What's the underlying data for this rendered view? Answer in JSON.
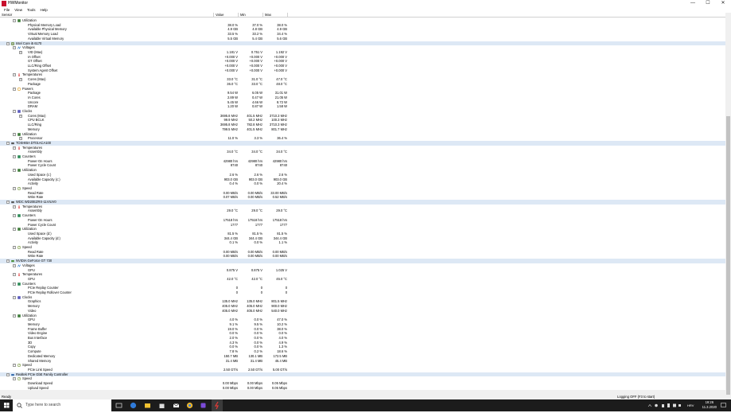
{
  "window": {
    "title": "HWMonitor",
    "minimize": "—",
    "maximize": "☐",
    "close": "✕"
  },
  "menu": [
    "File",
    "View",
    "Tools",
    "Help"
  ],
  "columns": {
    "sensor": "Sensor",
    "value": "Value",
    "min": "Min",
    "max": "Max"
  },
  "rows": [
    {
      "level": 2,
      "exp": "−",
      "icon": "util",
      "label": "Utilization"
    },
    {
      "level": 3,
      "label": "Physical Memory Load",
      "value": "38.0 %",
      "min": "37.0 %",
      "max": "38.0 %"
    },
    {
      "level": 3,
      "label": "Available Physical Memory",
      "value": "4.9 GB",
      "min": "4.8 GB",
      "max": "4.9 GB"
    },
    {
      "level": 3,
      "label": "Virtual Memory Load",
      "value": "33.5 %",
      "min": "33.2 %",
      "max": "34.4 %"
    },
    {
      "level": 3,
      "label": "Available Virtual Memory",
      "value": "5.5 GB",
      "min": "5.4 GB",
      "max": "5.6 GB"
    },
    {
      "level": 1,
      "exp": "−",
      "icon": "cpu",
      "label": "Intel Core i5 6170",
      "hw": true
    },
    {
      "level": 2,
      "exp": "−",
      "icon": "volt",
      "label": "Voltages"
    },
    {
      "level": 3,
      "exp": "+",
      "label": "VID (Max)",
      "value": "1.181 V",
      "min": "0.751 V",
      "max": "1.192 V"
    },
    {
      "level": 3,
      "label": "IA Offset",
      "value": "+0.000 V",
      "min": "+0.000 V",
      "max": "+0.000 V"
    },
    {
      "level": 3,
      "label": "GT Offset",
      "value": "+0.000 V",
      "min": "+0.000 V",
      "max": "+0.000 V"
    },
    {
      "level": 3,
      "label": "LLC/Ring Offset",
      "value": "+0.000 V",
      "min": "+0.000 V",
      "max": "+0.000 V"
    },
    {
      "level": 3,
      "label": "System Agent Offset",
      "value": "+0.000 V",
      "min": "+0.000 V",
      "max": "+0.000 V"
    },
    {
      "level": 2,
      "exp": "−",
      "icon": "temp",
      "label": "Temperatures"
    },
    {
      "level": 3,
      "exp": "+",
      "label": "Cores (Max)",
      "value": "33.0 °C",
      "min": "31.0 °C",
      "max": "47.0 °C"
    },
    {
      "level": 3,
      "label": "Package",
      "value": "36.0 °C",
      "min": "33.0 °C",
      "max": "48.0 °C"
    },
    {
      "level": 2,
      "exp": "−",
      "icon": "power",
      "label": "Powers"
    },
    {
      "level": 3,
      "label": "Package",
      "value": "9.54 W",
      "min": "6.05 W",
      "max": "31.01 W"
    },
    {
      "level": 3,
      "label": "IA Cores",
      "value": "2.89 W",
      "min": "0.47 W",
      "max": "21.05 W"
    },
    {
      "level": 3,
      "label": "Uncore",
      "value": "5.45 W",
      "min": "4.66 W",
      "max": "8.72 W"
    },
    {
      "level": 3,
      "label": "DRAM",
      "value": "1.20 W",
      "min": "0.87 W",
      "max": "1.58 W"
    },
    {
      "level": 2,
      "exp": "−",
      "icon": "clock",
      "label": "Clocks"
    },
    {
      "level": 3,
      "exp": "+",
      "label": "Cores (Max)",
      "value": "3695.8 MHz",
      "min": "401.5 MHz",
      "max": "3710.3 MHz"
    },
    {
      "level": 3,
      "label": "CPU BCLK",
      "value": "99.9 MHz",
      "min": "50.2 MHz",
      "max": "100.3 MHz"
    },
    {
      "level": 3,
      "label": "LLC/Ring",
      "value": "3695.8 MHz",
      "min": "782.8 MHz",
      "max": "3710.3 MHz"
    },
    {
      "level": 3,
      "label": "Memory",
      "value": "799.5 MHz",
      "min": "401.5 MHz",
      "max": "801.7 MHz"
    },
    {
      "level": 2,
      "exp": "−",
      "icon": "util",
      "label": "Utilization"
    },
    {
      "level": 3,
      "exp": "+",
      "label": "Processor",
      "value": "11.0 %",
      "min": "3.3 %",
      "max": "36.4 %"
    },
    {
      "level": 1,
      "exp": "−",
      "icon": "disk",
      "label": "TOSHIBA DT01ACA100",
      "hw": true
    },
    {
      "level": 2,
      "exp": "−",
      "icon": "temp",
      "label": "Temperatures"
    },
    {
      "level": 3,
      "label": "Assembly",
      "value": "34.0 °C",
      "min": "34.0 °C",
      "max": "34.0 °C"
    },
    {
      "level": 2,
      "exp": "−",
      "icon": "counter",
      "label": "Counters"
    },
    {
      "level": 3,
      "label": "Power-On Hours",
      "value": "42980 hrs",
      "min": "42980 hrs",
      "max": "42980 hrs"
    },
    {
      "level": 3,
      "label": "Power Cycle Count",
      "value": "8740",
      "min": "8740",
      "max": "8740"
    },
    {
      "level": 2,
      "exp": "−",
      "icon": "util",
      "label": "Utilization"
    },
    {
      "level": 3,
      "label": "Used Space (c:)",
      "value": "2.6 %",
      "min": "2.6 %",
      "max": "2.6 %"
    },
    {
      "level": 3,
      "label": "Available Capacity (c:)",
      "value": "903.0 GB",
      "min": "903.0 GB",
      "max": "903.0 GB"
    },
    {
      "level": 3,
      "label": "Activity",
      "value": "0.4 %",
      "min": "0.0 %",
      "max": "20.4 %"
    },
    {
      "level": 2,
      "exp": "−",
      "icon": "speed",
      "label": "Speed"
    },
    {
      "level": 3,
      "label": "Read Rate",
      "value": "0.00 MB/s",
      "min": "0.00 MB/s",
      "max": "33.00 MB/s"
    },
    {
      "level": 3,
      "label": "Write Rate",
      "value": "0.07 MB/s",
      "min": "0.00 MB/s",
      "max": "0.52 MB/s"
    },
    {
      "level": 1,
      "exp": "−",
      "icon": "disk",
      "label": "WDC WD20EZRX-11VIUV0",
      "hw": true
    },
    {
      "level": 2,
      "exp": "−",
      "icon": "temp",
      "label": "Temperatures"
    },
    {
      "level": 3,
      "label": "Assembly",
      "value": "29.0 °C",
      "min": "29.0 °C",
      "max": "29.0 °C"
    },
    {
      "level": 2,
      "exp": "−",
      "icon": "counter",
      "label": "Counters"
    },
    {
      "level": 3,
      "label": "Power-On Hours",
      "value": "17518 hrs",
      "min": "17518 hrs",
      "max": "17518 hrs"
    },
    {
      "level": 3,
      "label": "Power Cycle Count",
      "value": "1777",
      "min": "1777",
      "max": "1777"
    },
    {
      "level": 2,
      "exp": "−",
      "icon": "util",
      "label": "Utilization"
    },
    {
      "level": 3,
      "label": "Used Space (d:)",
      "value": "81.5 %",
      "min": "81.5 %",
      "max": "81.5 %"
    },
    {
      "level": 3,
      "label": "Available Capacity (d:)",
      "value": "344.4 GB",
      "min": "344.4 GB",
      "max": "344.4 GB"
    },
    {
      "level": 3,
      "label": "Activity",
      "value": "0.1 %",
      "min": "0.0 %",
      "max": "1.1 %"
    },
    {
      "level": 2,
      "exp": "−",
      "icon": "speed",
      "label": "Speed"
    },
    {
      "level": 3,
      "label": "Read Rate",
      "value": "0.00 MB/s",
      "min": "0.00 MB/s",
      "max": "0.00 MB/s"
    },
    {
      "level": 3,
      "label": "Write Rate",
      "value": "0.00 MB/s",
      "min": "0.00 MB/s",
      "max": "0.00 MB/s"
    },
    {
      "level": 1,
      "exp": "−",
      "icon": "gpu",
      "label": "NVIDIA GeForce GT 730",
      "hw": true
    },
    {
      "level": 2,
      "exp": "−",
      "icon": "volt",
      "label": "Voltages"
    },
    {
      "level": 3,
      "label": "GPU",
      "value": "0.875 V",
      "min": "0.875 V",
      "max": "1.025 V"
    },
    {
      "level": 2,
      "exp": "−",
      "icon": "temp",
      "label": "Temperatures"
    },
    {
      "level": 3,
      "label": "GPU",
      "value": "42.0 °C",
      "min": "42.0 °C",
      "max": "45.0 °C"
    },
    {
      "level": 2,
      "exp": "−",
      "icon": "counter",
      "label": "Counters"
    },
    {
      "level": 3,
      "label": "PCIe Replay Counter",
      "value": "0",
      "min": "0",
      "max": "0"
    },
    {
      "level": 3,
      "label": "PCIe Replay Rollover Counter",
      "value": "0",
      "min": "0",
      "max": "0"
    },
    {
      "level": 2,
      "exp": "−",
      "icon": "clock",
      "label": "Clocks"
    },
    {
      "level": 3,
      "label": "Graphics",
      "value": "135.0 MHz",
      "min": "135.0 MHz",
      "max": "801.5 MHz"
    },
    {
      "level": 3,
      "label": "Memory",
      "value": "405.0 MHz",
      "min": "405.0 MHz",
      "max": "900.0 MHz"
    },
    {
      "level": 3,
      "label": "Video",
      "value": "405.0 MHz",
      "min": "405.0 MHz",
      "max": "540.0 MHz"
    },
    {
      "level": 2,
      "exp": "−",
      "icon": "util",
      "label": "Utilization"
    },
    {
      "level": 3,
      "label": "GPU",
      "value": "4.0 %",
      "min": "0.0 %",
      "max": "47.0 %"
    },
    {
      "level": 3,
      "label": "Memory",
      "value": "9.1 %",
      "min": "9.5 %",
      "max": "10.2 %"
    },
    {
      "level": 3,
      "label": "Frame Buffer",
      "value": "19.0 %",
      "min": "0.0 %",
      "max": "38.0 %"
    },
    {
      "level": 3,
      "label": "Video Engine",
      "value": "0.0 %",
      "min": "0.0 %",
      "max": "0.0 %"
    },
    {
      "level": 3,
      "label": "Bus Interface",
      "value": "2.0 %",
      "min": "0.0 %",
      "max": "4.0 %"
    },
    {
      "level": 3,
      "label": "3D",
      "value": "4.3 %",
      "min": "0.0 %",
      "max": "4.9 %"
    },
    {
      "level": 3,
      "label": "Copy",
      "value": "0.0 %",
      "min": "0.0 %",
      "max": "1.3 %"
    },
    {
      "level": 3,
      "label": "Compute",
      "value": "7.8 %",
      "min": "0.2 %",
      "max": "18.6 %"
    },
    {
      "level": 3,
      "label": "Dedicated Memory",
      "value": "150.7 MB",
      "min": "130.1 MB",
      "max": "172.5 MB"
    },
    {
      "level": 3,
      "label": "Shared Memory",
      "value": "31.4 MB",
      "min": "31.4 MB",
      "max": "45.4 MB"
    },
    {
      "level": 2,
      "exp": "−",
      "icon": "speed",
      "label": "Speed"
    },
    {
      "level": 3,
      "label": "PCIe Link Speed",
      "value": "2.50 GT/s",
      "min": "2.50 GT/s",
      "max": "5.00 GT/s"
    },
    {
      "level": 1,
      "exp": "−",
      "icon": "net",
      "label": "Realtek PCIe GbE Family Controller",
      "hw": true
    },
    {
      "level": 2,
      "exp": "−",
      "icon": "speed",
      "label": "Speed"
    },
    {
      "level": 3,
      "label": "Download Speed",
      "value": "0.00 Mbps",
      "min": "0.00 Mbps",
      "max": "0.05 Mbps"
    },
    {
      "level": 3,
      "label": "Upload Speed",
      "value": "0.00 Mbps",
      "min": "0.00 Mbps",
      "max": "0.05 Mbps"
    }
  ],
  "status": {
    "left": "Ready",
    "right": "Logging OFF (F3 to start)"
  },
  "taskbar": {
    "search_placeholder": "Type here to search",
    "time": "19:26",
    "date": "11.3.2020",
    "lang": "HRV"
  },
  "colors": {
    "hw_row": "#dde8f5",
    "taskbar": "#1c1c1c",
    "app_icon": "#c8102e"
  }
}
